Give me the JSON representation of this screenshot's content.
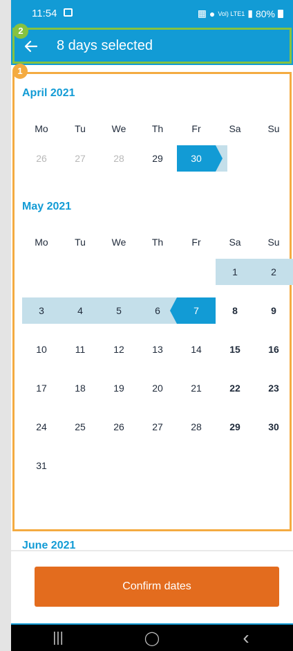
{
  "status_bar": {
    "time": "11:54",
    "battery_text": "80%",
    "network_text": "Vol) LTE1"
  },
  "header": {
    "title": "8 days selected"
  },
  "annotations": {
    "badge_1": "1",
    "badge_2": "2"
  },
  "weekdays": [
    "Mo",
    "Tu",
    "We",
    "Th",
    "Fr",
    "Sa",
    "Su"
  ],
  "months": [
    {
      "title": "April 2021",
      "weeks": [
        [
          {
            "d": "26",
            "state": "past"
          },
          {
            "d": "27",
            "state": "past"
          },
          {
            "d": "28",
            "state": "past"
          },
          {
            "d": "29",
            "state": "normal"
          },
          {
            "d": "30",
            "state": "start"
          },
          {
            "d": "",
            "state": "empty"
          },
          {
            "d": "",
            "state": "empty"
          }
        ]
      ]
    },
    {
      "title": "May 2021",
      "weeks": [
        [
          {
            "d": "",
            "state": "empty"
          },
          {
            "d": "",
            "state": "empty"
          },
          {
            "d": "",
            "state": "empty"
          },
          {
            "d": "",
            "state": "empty"
          },
          {
            "d": "",
            "state": "empty"
          },
          {
            "d": "1",
            "state": "range"
          },
          {
            "d": "2",
            "state": "range"
          }
        ],
        [
          {
            "d": "3",
            "state": "range"
          },
          {
            "d": "4",
            "state": "range"
          },
          {
            "d": "5",
            "state": "range"
          },
          {
            "d": "6",
            "state": "range"
          },
          {
            "d": "7",
            "state": "end"
          },
          {
            "d": "8",
            "state": "weekend"
          },
          {
            "d": "9",
            "state": "weekend"
          }
        ],
        [
          {
            "d": "10",
            "state": "normal"
          },
          {
            "d": "11",
            "state": "normal"
          },
          {
            "d": "12",
            "state": "normal"
          },
          {
            "d": "13",
            "state": "normal"
          },
          {
            "d": "14",
            "state": "normal"
          },
          {
            "d": "15",
            "state": "weekend"
          },
          {
            "d": "16",
            "state": "weekend"
          }
        ],
        [
          {
            "d": "17",
            "state": "normal"
          },
          {
            "d": "18",
            "state": "normal"
          },
          {
            "d": "19",
            "state": "normal"
          },
          {
            "d": "20",
            "state": "normal"
          },
          {
            "d": "21",
            "state": "normal"
          },
          {
            "d": "22",
            "state": "weekend"
          },
          {
            "d": "23",
            "state": "weekend"
          }
        ],
        [
          {
            "d": "24",
            "state": "normal"
          },
          {
            "d": "25",
            "state": "normal"
          },
          {
            "d": "26",
            "state": "normal"
          },
          {
            "d": "27",
            "state": "normal"
          },
          {
            "d": "28",
            "state": "normal"
          },
          {
            "d": "29",
            "state": "weekend"
          },
          {
            "d": "30",
            "state": "weekend"
          }
        ],
        [
          {
            "d": "31",
            "state": "normal"
          },
          {
            "d": "",
            "state": "empty"
          },
          {
            "d": "",
            "state": "empty"
          },
          {
            "d": "",
            "state": "empty"
          },
          {
            "d": "",
            "state": "empty"
          },
          {
            "d": "",
            "state": "empty"
          },
          {
            "d": "",
            "state": "empty"
          }
        ]
      ]
    }
  ],
  "next_month_title": "June 2021",
  "confirm_button": {
    "label": "Confirm dates"
  },
  "nav_bar": {
    "recents": "|||",
    "home": "◯",
    "back": "‹"
  },
  "colors": {
    "primary": "#129bd5",
    "range": "#c4dfea",
    "confirm": "#e36c1e",
    "highlight_1": "#f4ab41",
    "highlight_2": "#86c240"
  }
}
